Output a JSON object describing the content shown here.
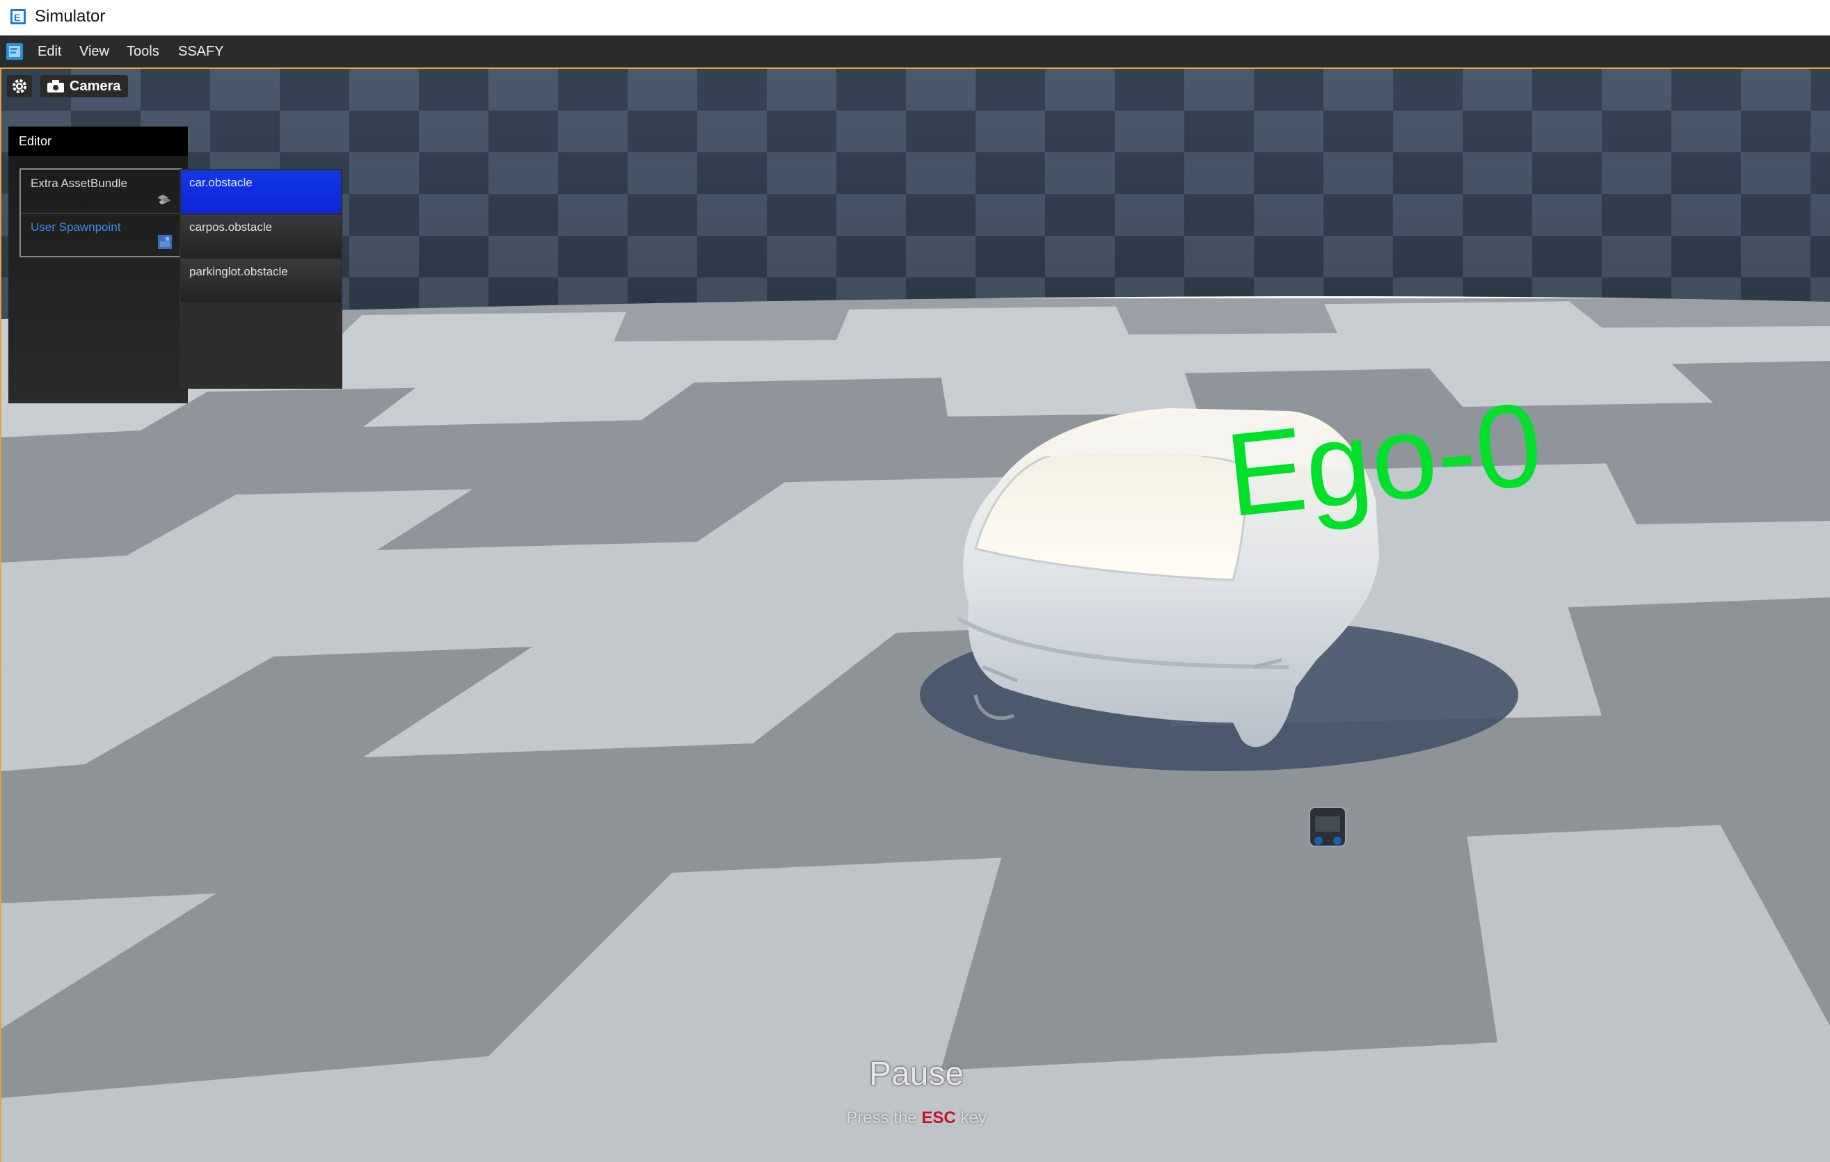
{
  "window": {
    "title": "Simulator"
  },
  "menu": {
    "items": [
      {
        "label": "Edit"
      },
      {
        "label": "View"
      },
      {
        "label": "Tools"
      },
      {
        "label": "SSAFY"
      }
    ]
  },
  "toolbar": {
    "settings_icon": "gear-icon",
    "camera_label": "Camera",
    "camera_icon": "camera-icon"
  },
  "editor": {
    "title": "Editor",
    "items": [
      {
        "label": "Extra AssetBundle",
        "icon": "asset-bundle-icon"
      },
      {
        "label": "User Spawnpoint",
        "icon": "spawnpoint-icon"
      }
    ],
    "obstacles": [
      {
        "label": "car.obstacle",
        "selected": true
      },
      {
        "label": "carpos.obstacle",
        "selected": false
      },
      {
        "label": "parkinglot.obstacle",
        "selected": false
      }
    ]
  },
  "scene": {
    "vehicle_label": "Ego-0",
    "label_color": "#00e02a"
  },
  "pause": {
    "title": "Pause",
    "hint_prefix": "Press the",
    "hint_key": "ESC",
    "hint_suffix": "key"
  },
  "colors": {
    "accent_border": "#e8a23c",
    "selection": "#1437e6",
    "link": "#3b8cf0",
    "esc_key": "#c8102e"
  }
}
